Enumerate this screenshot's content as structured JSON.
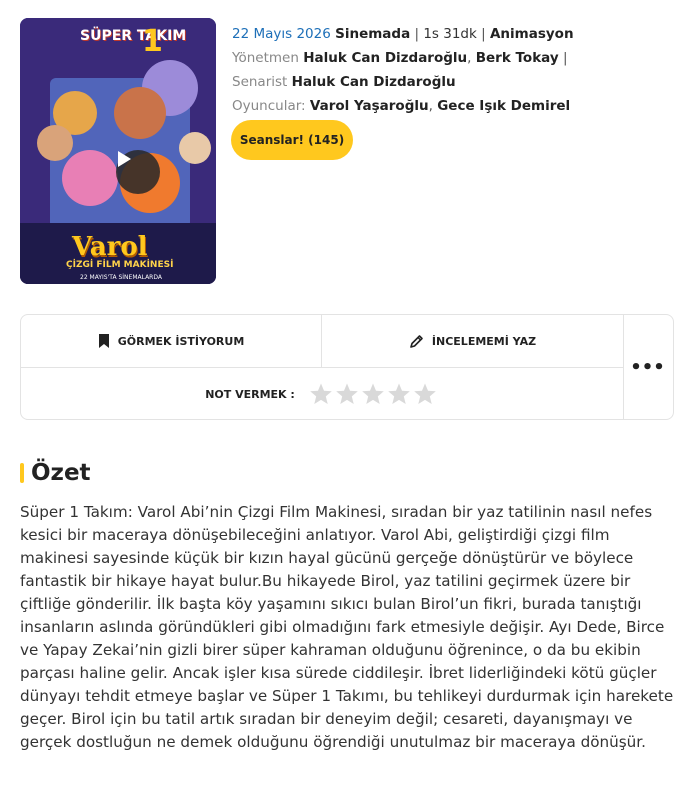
{
  "movie": {
    "poster_title": "SÜPER TAKIM",
    "poster_number": "1",
    "poster_subtitle": "Varol",
    "poster_tagline": "ÇİZGİ FİLM MAKİNESİ",
    "poster_date": "22 MAYIS'TA SİNEMALARDA",
    "release_date": "22 Mayıs 2026",
    "status": "Sinemada",
    "duration": "1s 31dk",
    "genre": "Animasyon",
    "director_label": "Yönetmen",
    "directors": [
      "Haluk Can Dizdaroğlu",
      "Berk Tokay"
    ],
    "writer_label": "Senarist",
    "writers": [
      "Haluk Can Dizdaroğlu"
    ],
    "cast_label": "Oyuncular:",
    "cast": [
      "Varol Yaşaroğlu",
      "Gece Işık Demirel"
    ],
    "sessions_button": "Seanslar! (145)"
  },
  "actions": {
    "watchlist_label": "GÖRMEK İSTİYORUM",
    "review_label": "İNCELEMEMİ YAZ",
    "rating_label": "NOT VERMEK :",
    "rating_max": 5,
    "rating_value": 0,
    "more_label": "•••"
  },
  "summary": {
    "title": "Özet",
    "text": "Süper 1 Takım: Varol Abi’nin Çizgi Film Makinesi, sıradan bir yaz tatilinin nasıl nefes kesici bir maceraya dönüşebileceğini anlatıyor. Varol Abi, geliştirdiği çizgi film makinesi sayesinde küçük bir kızın hayal gücünü gerçeğe dönüştürür ve böylece fantastik bir hikaye hayat bulur.Bu hikayede Birol, yaz tatilini geçirmek üzere bir çiftliğe gönderilir. İlk başta köy yaşamını sıkıcı bulan Birol’un fikri, burada tanıştığı insanların aslında göründükleri gibi olmadığını fark etmesiyle değişir. Ayı Dede, Birce ve Yapay Zekai’nin gizli birer süper kahraman olduğunu öğrenince, o da bu ekibin parçası haline gelir. Ancak işler kısa sürede ciddileşir. İbret liderliğindeki kötü güçler dünyayı tehdit etmeye başlar ve Süper 1 Takımı, bu tehlikeyi durdurmak için harekete geçer. Birol için bu tatil artık sıradan bir deneyim değil; cesareti, dayanışmayı ve gerçek dostluğun ne demek olduğunu öğrendiği unutulmaz bir maceraya dönüşür."
  },
  "colors": {
    "accent": "#ffc81e",
    "date_link": "#1d6fb8",
    "star_empty": "#d9d9d9"
  }
}
